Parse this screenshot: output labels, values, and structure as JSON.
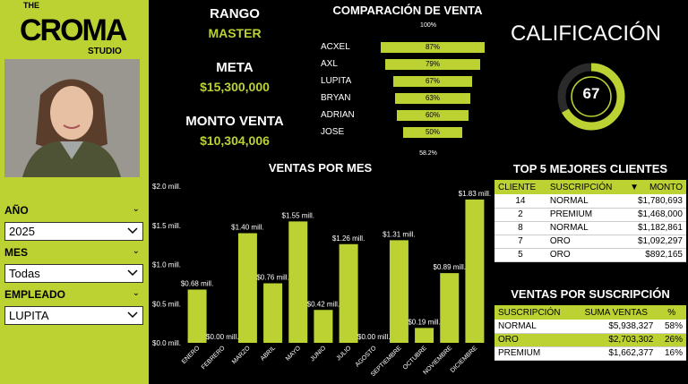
{
  "brand": {
    "the": "THE",
    "name": "CROMA",
    "sub": "STUDIO"
  },
  "colors": {
    "accent": "#bcd232",
    "background": "#000000"
  },
  "filters": {
    "year": {
      "label": "AÑO",
      "value": "2025"
    },
    "month": {
      "label": "MES",
      "value": "Todas"
    },
    "employee": {
      "label": "EMPLEADO",
      "value": "LUPITA"
    }
  },
  "kpis": {
    "rango_label": "RANGO",
    "rango_value": "MASTER",
    "meta_label": "META",
    "meta_value": "$15,300,000",
    "monto_label": "MONTO VENTA",
    "monto_value": "$10,304,006"
  },
  "funnel": {
    "title": "COMPARACIÓN DE VENTA",
    "top_label": "100%",
    "bottom_label": "58.2%",
    "items": [
      {
        "name": "ACXEL",
        "pct": "87%",
        "value": 87
      },
      {
        "name": "AXL",
        "pct": "79%",
        "value": 79
      },
      {
        "name": "LUPITA",
        "pct": "67%",
        "value": 67
      },
      {
        "name": "BRYAN",
        "pct": "63%",
        "value": 63
      },
      {
        "name": "ADRIAN",
        "pct": "60%",
        "value": 60
      },
      {
        "name": "JOSE",
        "pct": "50%",
        "value": 50
      }
    ]
  },
  "calificacion": {
    "title": "CALIFICACIÓN",
    "value": "67",
    "fraction": 0.67
  },
  "top_clients": {
    "title": "TOP 5 MEJORES CLIENTES",
    "headers": [
      "CLIENTE",
      "SUSCRIPCIÓN",
      "MONTO"
    ],
    "rows": [
      [
        "14",
        "NORMAL",
        "$1,780,693"
      ],
      [
        "2",
        "PREMIUM",
        "$1,468,000"
      ],
      [
        "8",
        "NORMAL",
        "$1,182,861"
      ],
      [
        "7",
        "ORO",
        "$1,092,297"
      ],
      [
        "5",
        "ORO",
        "$892,165"
      ]
    ]
  },
  "subs": {
    "title": "VENTAS POR SUSCRIPCIÓN",
    "headers": [
      "SUSCRIPCIÓN",
      "SUMA VENTAS",
      "%"
    ],
    "rows": [
      [
        "NORMAL",
        "$5,938,327",
        "58%"
      ],
      [
        "ORO",
        "$2,703,302",
        "26%"
      ],
      [
        "PREMIUM",
        "$1,662,377",
        "16%"
      ]
    ]
  },
  "chart_data": {
    "type": "bar",
    "title": "VENTAS POR MES",
    "categories": [
      "ENERO",
      "FEBRERO",
      "MARZO",
      "ABRIL",
      "MAYO",
      "JUNIO",
      "JULIO",
      "AGOSTO",
      "SEPTIEMBRE",
      "OCTUBRE",
      "NOVIEMBRE",
      "DICIEMBRE"
    ],
    "values": [
      0.68,
      0.0,
      1.4,
      0.76,
      1.55,
      0.42,
      1.26,
      0.0,
      1.31,
      0.19,
      0.89,
      1.83
    ],
    "value_labels": [
      "$0.68 mill.",
      "$0.00 mill.",
      "$1.40 mill.",
      "$0.76 mill.",
      "$1.55 mill.",
      "$0.42 mill.",
      "$1.26 mill.",
      "$0.00 mill.",
      "$1.31 mill.",
      "$0.19 mill.",
      "$0.89 mill.",
      "$1.83 mill."
    ],
    "ytick_labels": [
      "$0.0 mill.",
      "$0.5 mill.",
      "$1.0 mill.",
      "$1.5 mill.",
      "$2.0 mill."
    ],
    "yticks": [
      0,
      0.5,
      1.0,
      1.5,
      2.0
    ],
    "ylim": [
      0,
      2.0
    ],
    "grid": false
  }
}
